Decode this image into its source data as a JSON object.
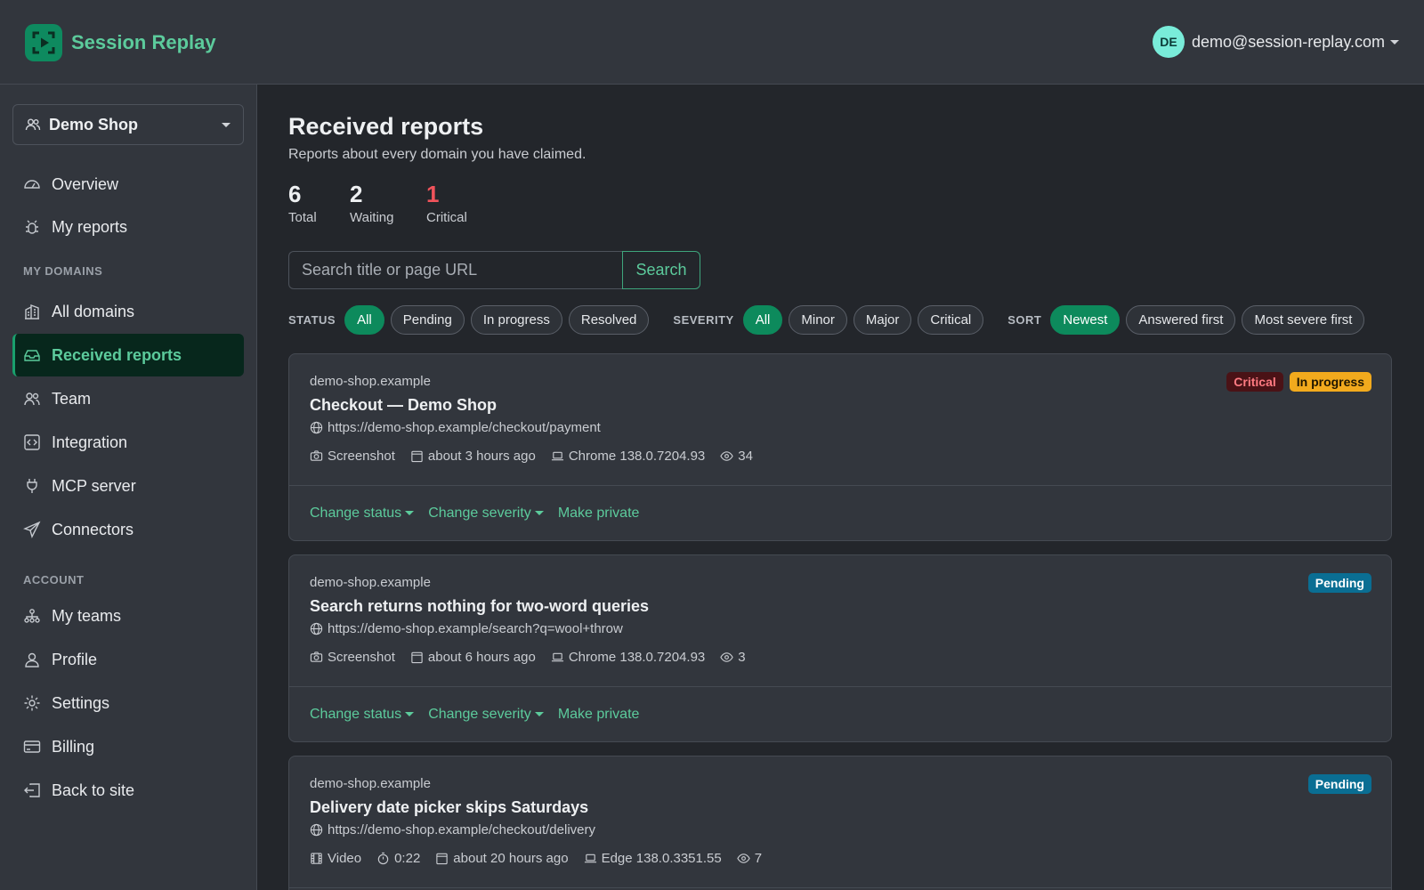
{
  "app": {
    "name": "Session Replay"
  },
  "user": {
    "initials": "DE",
    "email": "demo@session-replay.com"
  },
  "project": {
    "name": "Demo Shop"
  },
  "nav": {
    "overview": "Overview",
    "my_reports": "My reports",
    "section_domains": "MY DOMAINS",
    "all_domains": "All domains",
    "received_reports": "Received reports",
    "team": "Team",
    "integration": "Integration",
    "mcp_server": "MCP server",
    "connectors": "Connectors",
    "section_account": "ACCOUNT",
    "my_teams": "My teams",
    "profile": "Profile",
    "settings": "Settings",
    "billing": "Billing",
    "back_to_site": "Back to site"
  },
  "page": {
    "title": "Received reports",
    "subtitle": "Reports about every domain you have claimed."
  },
  "stats": {
    "total": {
      "value": "6",
      "label": "Total"
    },
    "waiting": {
      "value": "2",
      "label": "Waiting"
    },
    "critical": {
      "value": "1",
      "label": "Critical"
    }
  },
  "search": {
    "placeholder": "Search title or page URL",
    "button": "Search"
  },
  "filters": {
    "status_label": "STATUS",
    "status": [
      "All",
      "Pending",
      "In progress",
      "Resolved"
    ],
    "severity_label": "SEVERITY",
    "severity": [
      "All",
      "Minor",
      "Major",
      "Critical"
    ],
    "sort_label": "SORT",
    "sort": [
      "Newest",
      "Answered first",
      "Most severe first"
    ]
  },
  "reports": [
    {
      "domain": "demo-shop.example",
      "title": "Checkout — Demo Shop",
      "url": "https://demo-shop.example/checkout/payment",
      "media": "Screenshot",
      "time": "about 3 hours ago",
      "browser": "Chrome 138.0.7204.93",
      "views": "34",
      "badges": [
        "Critical",
        "In progress"
      ]
    },
    {
      "domain": "demo-shop.example",
      "title": "Search returns nothing for two-word queries",
      "url": "https://demo-shop.example/search?q=wool+throw",
      "media": "Screenshot",
      "time": "about 6 hours ago",
      "browser": "Chrome 138.0.7204.93",
      "views": "3",
      "badges": [
        "Pending"
      ]
    },
    {
      "domain": "demo-shop.example",
      "title": "Delivery date picker skips Saturdays",
      "url": "https://demo-shop.example/checkout/delivery",
      "media": "Video",
      "duration": "0:22",
      "time": "about 20 hours ago",
      "browser": "Edge 138.0.3351.55",
      "views": "7",
      "badges": [
        "Pending"
      ]
    }
  ],
  "actions": {
    "change_status": "Change status",
    "change_severity": "Change severity",
    "make_private": "Make private"
  }
}
